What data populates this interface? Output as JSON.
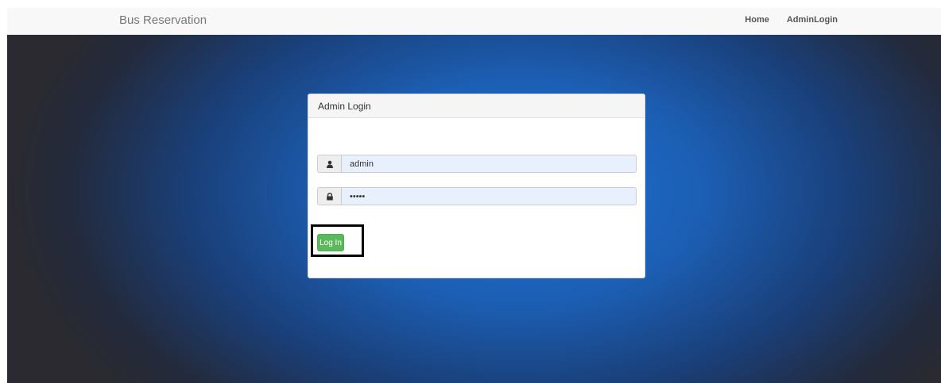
{
  "navbar": {
    "brand": "Bus Reservation",
    "links": [
      {
        "label": "Home"
      },
      {
        "label": "AdminLogin"
      }
    ]
  },
  "panel": {
    "heading": "Admin Login",
    "username": {
      "value": "admin",
      "icon": "user-icon"
    },
    "password": {
      "value": "•••••",
      "icon": "lock-icon"
    },
    "submit_label": "Log In"
  },
  "colors": {
    "button": "#5cb85c",
    "input_fill": "#e8f0fe",
    "hero_center": "#1d6fd1"
  }
}
